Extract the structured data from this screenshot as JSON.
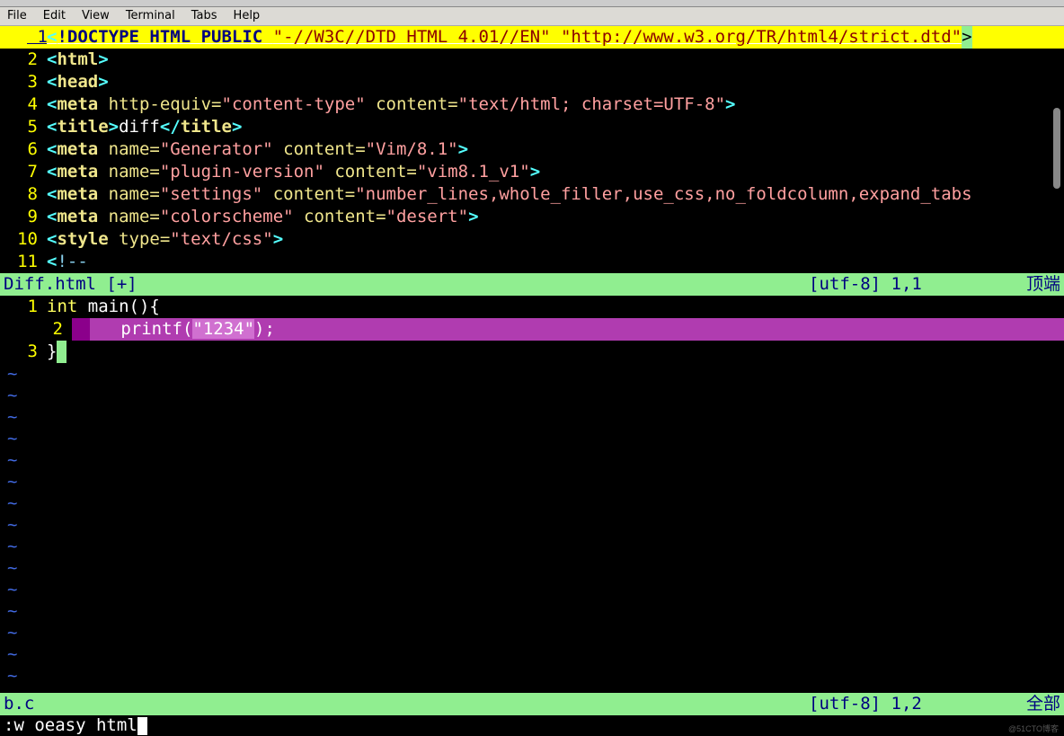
{
  "menubar": [
    "File",
    "Edit",
    "View",
    "Terminal",
    "Tabs",
    "Help"
  ],
  "pane1": {
    "filename": "Diff.html [+]",
    "encoding": "[utf-8]",
    "cursor": "1,1",
    "position": "顶端",
    "lines": [
      {
        "n": 1,
        "html": "<!DOCTYPE HTML PUBLIC \"-//W3C//DTD HTML 4.01//EN\" \"http://www.w3.org/TR/html4/strict.dtd\">"
      },
      {
        "n": 2,
        "html": "<html>"
      },
      {
        "n": 3,
        "html": "<head>"
      },
      {
        "n": 4,
        "html": "<meta http-equiv=\"content-type\" content=\"text/html; charset=UTF-8\">"
      },
      {
        "n": 5,
        "html": "<title>diff</title>"
      },
      {
        "n": 6,
        "html": "<meta name=\"Generator\" content=\"Vim/8.1\">"
      },
      {
        "n": 7,
        "html": "<meta name=\"plugin-version\" content=\"vim8.1_v1\">"
      },
      {
        "n": 8,
        "html": "<meta name=\"settings\" content=\"number_lines,whole_filler,use_css,no_foldcolumn,expand_tabs"
      },
      {
        "n": 9,
        "html": "<meta name=\"colorscheme\" content=\"desert\">"
      },
      {
        "n": 10,
        "html": "<style type=\"text/css\">"
      },
      {
        "n": 11,
        "html": "<!--"
      }
    ]
  },
  "pane2": {
    "filename": "b.c",
    "encoding": "[utf-8]",
    "cursor": "1,2",
    "position": "全部",
    "lines": [
      {
        "n": 1,
        "code": "int main(){"
      },
      {
        "n": 2,
        "code": "    printf(\"1234\");"
      },
      {
        "n": 3,
        "code": "}"
      }
    ]
  },
  "cmdline": ":w oeasy html",
  "watermark": "@51CTO博客"
}
